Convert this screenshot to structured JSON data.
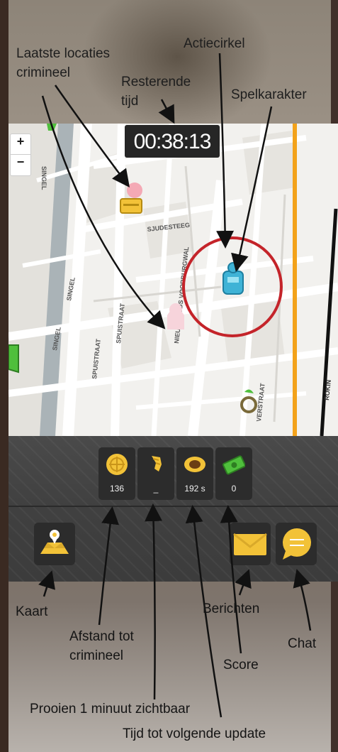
{
  "game": {
    "timer": "00:38:13",
    "zoom": {
      "in": "+",
      "out": "−"
    },
    "map_labels": {
      "singel_1": "SINGEL",
      "singel_2": "SINGEL",
      "spuistraat_1": "SPUISTRAAT",
      "spuistraat_2": "SPUISTRAAT",
      "steeg": "SJUDESTEEG",
      "voorburgwal": "NIEUWEZIJDS VOORBURGWAL",
      "straat": "VERSTRAAT",
      "rokin": "ROKIN"
    },
    "stats": [
      {
        "name": "distance",
        "icon": "target-coin-icon",
        "value": "136"
      },
      {
        "name": "prey",
        "icon": "croissant-icon",
        "value": "_"
      },
      {
        "name": "time-to-update",
        "icon": "eye-icon",
        "value": "192 s"
      },
      {
        "name": "score",
        "icon": "money-icon",
        "value": "0"
      }
    ],
    "buttons": {
      "map": {
        "icon": "map-pin-icon"
      },
      "messages": {
        "icon": "envelope-icon"
      },
      "chat": {
        "icon": "chat-bubble-icon"
      }
    },
    "colors": {
      "accent_gold": "#f2c238",
      "action_circle": "#c4242a",
      "player": "#3fb3d6",
      "panel": "#404040"
    }
  },
  "annotations": {
    "last_locations": [
      "Laatste locaties",
      "crimineel"
    ],
    "remaining_time": [
      "Resterende",
      "tijd"
    ],
    "action_circle": "Actiecirkel",
    "game_character": "Spelkarakter",
    "map": "Kaart",
    "distance": [
      "Afstand tot",
      "crimineel"
    ],
    "prey_visible": "Prooien 1 minuut zichtbaar",
    "time_next_update": "Tijd tot volgende update",
    "score": "Score",
    "messages": "Berichten",
    "chat": "Chat"
  }
}
